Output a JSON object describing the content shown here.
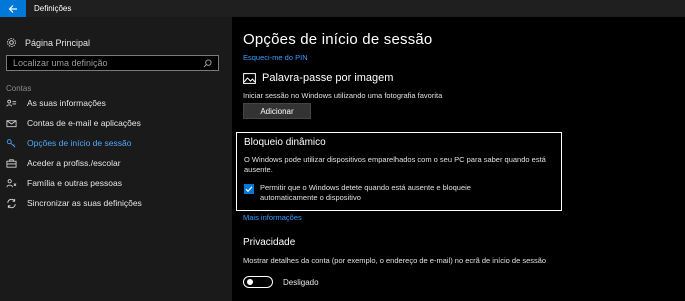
{
  "window": {
    "title": "Definições"
  },
  "sidebar": {
    "home_label": "Página Principal",
    "search_placeholder": "Localizar uma definição",
    "section_label": "Contas",
    "items": [
      {
        "label": "As suas informações",
        "icon": "person-info-icon"
      },
      {
        "label": "Contas de e-mail e aplicações",
        "icon": "mail-icon"
      },
      {
        "label": "Opções de início de sessão",
        "icon": "key-icon",
        "selected": true
      },
      {
        "label": "Aceder a profiss./escolar",
        "icon": "briefcase-icon"
      },
      {
        "label": "Família e outras pessoas",
        "icon": "people-icon"
      },
      {
        "label": "Sincronizar as suas definições",
        "icon": "sync-icon"
      }
    ]
  },
  "main": {
    "title": "Opções de início de sessão",
    "pin_link": "Esqueci-me do PIN",
    "picture_password": {
      "heading": "Palavra-passe por imagem",
      "description": "Iniciar sessão no Windows utilizando uma fotografia favorita",
      "add_button": "Adicionar"
    },
    "dynamic_lock": {
      "heading": "Bloqueio dinâmico",
      "description": "O Windows pode utilizar dispositivos emparelhados com o seu PC para saber quando está ausente.",
      "checkbox_label": "Permitir que o Windows detete quando está ausente e bloqueie automaticamente o dispositivo",
      "checked": true
    },
    "more_info_link": "Mais informações",
    "privacy": {
      "heading": "Privacidade",
      "description": "Mostrar detalhes da conta (por exemplo, o endereço de e-mail) no ecrã de início de sessão",
      "toggle_label": "Desligado",
      "toggle_on": false
    }
  },
  "colors": {
    "accent": "#0078d7",
    "link": "#3b9cff",
    "background": "#000000",
    "sidebar": "#1a1a1a"
  }
}
